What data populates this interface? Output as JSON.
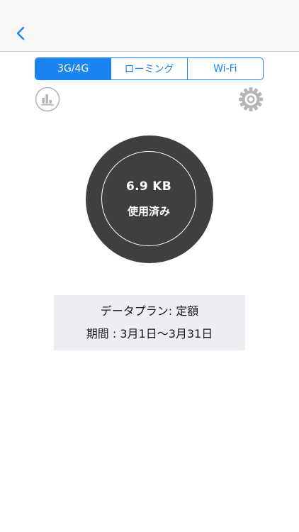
{
  "nav": {
    "back_icon": "chevron-left-icon",
    "accent_color": "#1a84f0"
  },
  "tabs": [
    {
      "label": "3G/4G",
      "selected": true
    },
    {
      "label": "ローミング",
      "selected": false
    },
    {
      "label": "Wi-Fi",
      "selected": false
    }
  ],
  "toolbar": {
    "stats_icon": "bar-chart-icon",
    "settings_icon": "gear-icon"
  },
  "usage": {
    "amount": "6.9 KB",
    "label": "使用済み",
    "circle_color": "#3f3f3f"
  },
  "plan": {
    "type_text": "データプラン: 定額",
    "period_text": "期間 : 3月1日〜3月31日"
  }
}
